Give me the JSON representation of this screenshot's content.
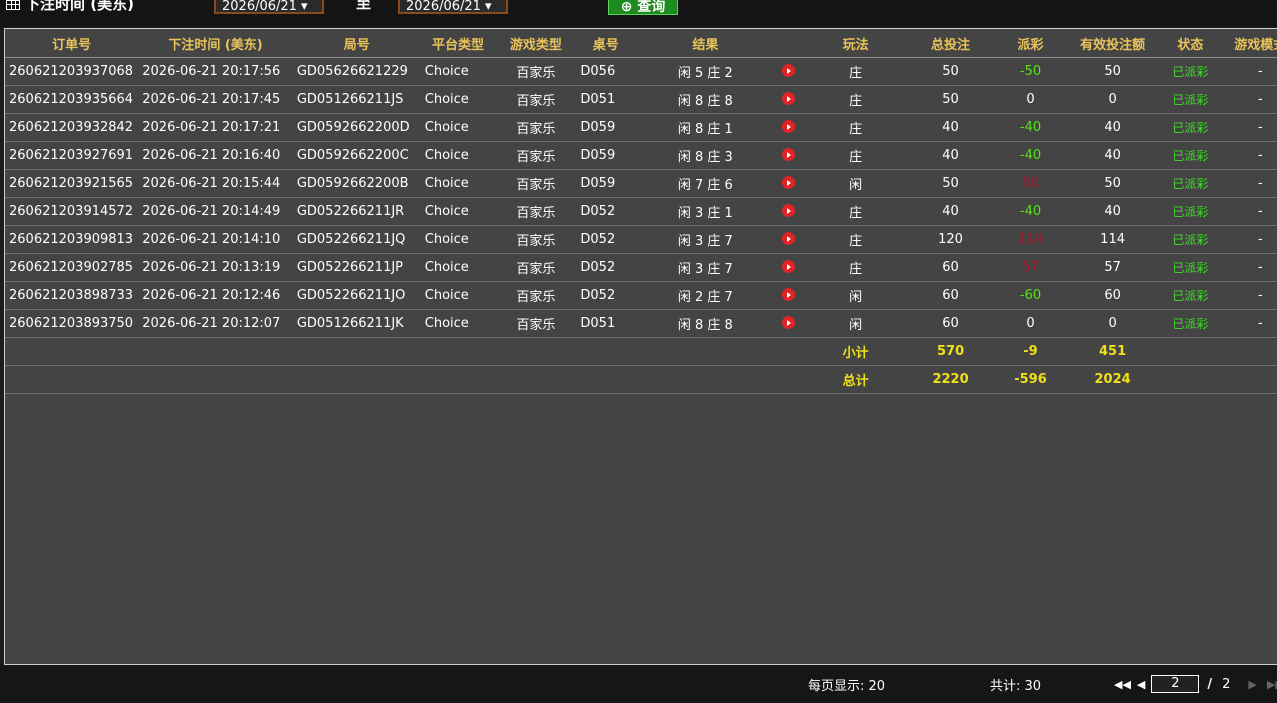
{
  "filter": {
    "date_label": "下注时间 (美东)",
    "from_date": "2026/06/21 ▾",
    "to_label": "至",
    "to_date": "2026/06/21 ▾",
    "query_label": "⊕ 查询"
  },
  "table": {
    "headers": [
      "订单号",
      "下注时间 (美东)",
      "局号",
      "平台类型",
      "游戏类型",
      "桌号",
      "结果",
      "",
      "玩法",
      "总投注",
      "派彩",
      "有效投注额",
      "状态",
      "游戏模式"
    ],
    "rows": [
      {
        "order": "260621203937068",
        "time": "2026-06-21 20:17:56",
        "round": "GD05626621229",
        "platform": "Choice",
        "game": "百家乐",
        "table": "D056",
        "result": "闲 5 庄 2",
        "bet_type": "庄",
        "total_bet": "50",
        "payout": "-50",
        "payout_sign": "neg",
        "valid_bet": "50",
        "status": "已派彩",
        "mode": "-"
      },
      {
        "order": "260621203935664",
        "time": "2026-06-21 20:17:45",
        "round": "GD051266211JS",
        "platform": "Choice",
        "game": "百家乐",
        "table": "D051",
        "result": "闲 8 庄 8",
        "bet_type": "庄",
        "total_bet": "50",
        "payout": "0",
        "payout_sign": "zero",
        "valid_bet": "0",
        "status": "已派彩",
        "mode": "-"
      },
      {
        "order": "260621203932842",
        "time": "2026-06-21 20:17:21",
        "round": "GD0592662200D",
        "platform": "Choice",
        "game": "百家乐",
        "table": "D059",
        "result": "闲 8 庄 1",
        "bet_type": "庄",
        "total_bet": "40",
        "payout": "-40",
        "payout_sign": "neg",
        "valid_bet": "40",
        "status": "已派彩",
        "mode": "-"
      },
      {
        "order": "260621203927691",
        "time": "2026-06-21 20:16:40",
        "round": "GD0592662200C",
        "platform": "Choice",
        "game": "百家乐",
        "table": "D059",
        "result": "闲 8 庄 3",
        "bet_type": "庄",
        "total_bet": "40",
        "payout": "-40",
        "payout_sign": "neg",
        "valid_bet": "40",
        "status": "已派彩",
        "mode": "-"
      },
      {
        "order": "260621203921565",
        "time": "2026-06-21 20:15:44",
        "round": "GD0592662200B",
        "platform": "Choice",
        "game": "百家乐",
        "table": "D059",
        "result": "闲 7 庄 6",
        "bet_type": "闲",
        "total_bet": "50",
        "payout": "50",
        "payout_sign": "pos",
        "valid_bet": "50",
        "status": "已派彩",
        "mode": "-"
      },
      {
        "order": "260621203914572",
        "time": "2026-06-21 20:14:49",
        "round": "GD052266211JR",
        "platform": "Choice",
        "game": "百家乐",
        "table": "D052",
        "result": "闲 3 庄 1",
        "bet_type": "庄",
        "total_bet": "40",
        "payout": "-40",
        "payout_sign": "neg",
        "valid_bet": "40",
        "status": "已派彩",
        "mode": "-"
      },
      {
        "order": "260621203909813",
        "time": "2026-06-21 20:14:10",
        "round": "GD052266211JQ",
        "platform": "Choice",
        "game": "百家乐",
        "table": "D052",
        "result": "闲 3 庄 7",
        "bet_type": "庄",
        "total_bet": "120",
        "payout": "114",
        "payout_sign": "pos",
        "valid_bet": "114",
        "status": "已派彩",
        "mode": "-"
      },
      {
        "order": "260621203902785",
        "time": "2026-06-21 20:13:19",
        "round": "GD052266211JP",
        "platform": "Choice",
        "game": "百家乐",
        "table": "D052",
        "result": "闲 3 庄 7",
        "bet_type": "庄",
        "total_bet": "60",
        "payout": "57",
        "payout_sign": "pos",
        "valid_bet": "57",
        "status": "已派彩",
        "mode": "-"
      },
      {
        "order": "260621203898733",
        "time": "2026-06-21 20:12:46",
        "round": "GD052266211JO",
        "platform": "Choice",
        "game": "百家乐",
        "table": "D052",
        "result": "闲 2 庄 7",
        "bet_type": "闲",
        "total_bet": "60",
        "payout": "-60",
        "payout_sign": "neg",
        "valid_bet": "60",
        "status": "已派彩",
        "mode": "-"
      },
      {
        "order": "260621203893750",
        "time": "2026-06-21 20:12:07",
        "round": "GD051266211JK",
        "platform": "Choice",
        "game": "百家乐",
        "table": "D051",
        "result": "闲 8 庄 8",
        "bet_type": "闲",
        "total_bet": "60",
        "payout": "0",
        "payout_sign": "zero",
        "valid_bet": "0",
        "status": "已派彩",
        "mode": "-"
      }
    ],
    "subtotal": {
      "label": "小计",
      "total_bet": "570",
      "payout": "-9",
      "valid_bet": "451"
    },
    "grand_total": {
      "label": "总计",
      "total_bet": "2220",
      "payout": "-596",
      "valid_bet": "2024"
    }
  },
  "footer": {
    "per_page": "每页显示: 20",
    "total": "共计: 30",
    "current_page": "2",
    "slash": "/",
    "total_pages": "2"
  },
  "colors": {
    "header_text": "#e8c35a",
    "negative_payout": "#59e01a",
    "positive_payout": "#a0152c",
    "status_text": "#3ddd27",
    "total_text": "#f0e01a"
  }
}
